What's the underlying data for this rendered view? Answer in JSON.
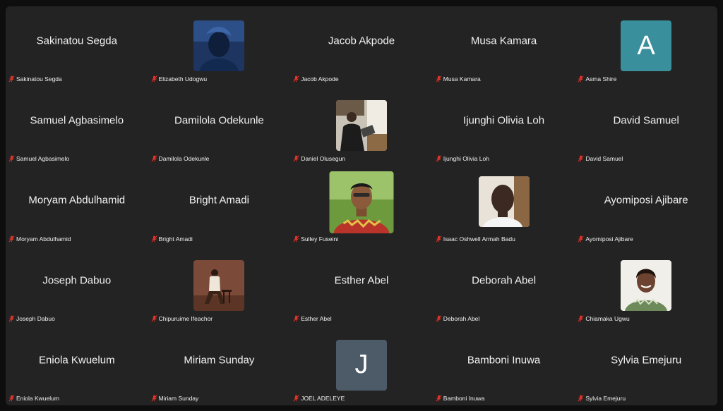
{
  "initial_colors": {
    "A": "#3a8f9c",
    "J": "#4d5a68"
  },
  "tiles": [
    {
      "kind": "name",
      "display": "Sakinatou Segda",
      "label": "Sakinatou Segda"
    },
    {
      "kind": "photo",
      "photo": "elizabeth",
      "label": "Elizabeth Udogwu"
    },
    {
      "kind": "name",
      "display": "Jacob Akpode",
      "label": "Jacob Akpode"
    },
    {
      "kind": "name",
      "display": "Musa Kamara",
      "label": "Musa Kamara"
    },
    {
      "kind": "initial",
      "initial": "A",
      "label": "Asma Shire"
    },
    {
      "kind": "name",
      "display": "Samuel Agbasimelo",
      "label": "Samuel Agbasimelo"
    },
    {
      "kind": "name",
      "display": "Damilola Odekunle",
      "label": "Damilola Odekunle"
    },
    {
      "kind": "photo",
      "photo": "daniel",
      "label": "Daniel Olusegun"
    },
    {
      "kind": "name",
      "display": "Ijunghi Olivia Loh",
      "label": "Ijunghi Olivia Loh"
    },
    {
      "kind": "name",
      "display": "David Samuel",
      "label": "David Samuel"
    },
    {
      "kind": "name",
      "display": "Moryam Abdulhamid",
      "label": "Moryam Abdulhamid"
    },
    {
      "kind": "name",
      "display": "Bright Amadi",
      "label": "Bright Amadi"
    },
    {
      "kind": "photo",
      "photo": "sulley",
      "label": "Sulley Fuseini"
    },
    {
      "kind": "photo",
      "photo": "isaac",
      "label": "Isaac Oshwell Armah Badu"
    },
    {
      "kind": "name",
      "display": "Ayomiposi Ajibare",
      "label": "Ayomiposi Ajibare"
    },
    {
      "kind": "name",
      "display": "Joseph Dabuo",
      "label": "Joseph Dabuo"
    },
    {
      "kind": "photo",
      "photo": "chipuruime",
      "label": "Chipuruime Ifeachor"
    },
    {
      "kind": "name",
      "display": "Esther Abel",
      "label": "Esther Abel"
    },
    {
      "kind": "name",
      "display": "Deborah Abel",
      "label": "Deborah Abel"
    },
    {
      "kind": "photo",
      "photo": "chiamaka",
      "label": "Chiamaka Ugwu"
    },
    {
      "kind": "name",
      "display": "Eniola Kwuelum",
      "label": "Eniola Kwuelum"
    },
    {
      "kind": "name",
      "display": "Miriam Sunday",
      "label": "Miriam Sunday"
    },
    {
      "kind": "initial",
      "initial": "J",
      "label": "JOEL ADELEYE"
    },
    {
      "kind": "name",
      "display": "Bamboni Inuwa",
      "label": "Bamboni Inuwa"
    },
    {
      "kind": "name",
      "display": "Sylvia Emejuru",
      "label": "Sylvia Emejuru"
    }
  ]
}
